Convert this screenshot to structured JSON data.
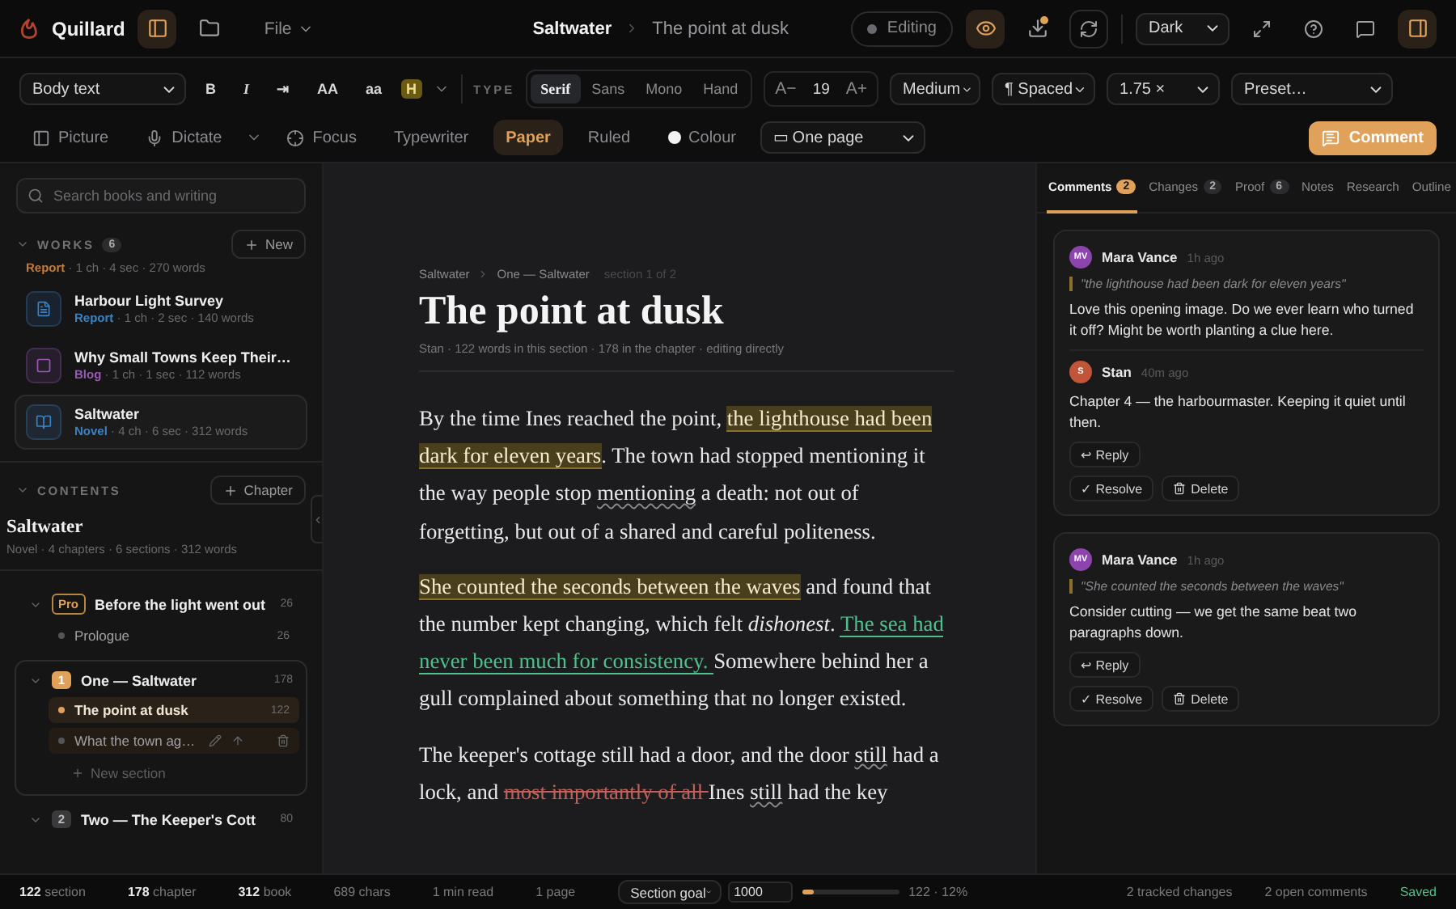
{
  "topbar": {
    "app_name": "Quillard",
    "file_menu": "File",
    "work": "Saltwater",
    "section": "The point at dusk",
    "mode": "Editing",
    "theme": "Dark",
    "left_panel_on": true,
    "preview_on": true,
    "download_badge": true,
    "right_panel_on": true
  },
  "toolbar": {
    "style": "Body text",
    "format": [
      {
        "label": "B",
        "kind": "bold"
      },
      {
        "label": "I",
        "kind": "italic"
      },
      {
        "label": "⇥",
        "kind": "plain"
      },
      {
        "label": "AA",
        "kind": "plain"
      },
      {
        "label": "aa",
        "kind": "plain"
      },
      {
        "label": "H",
        "kind": "highlight"
      }
    ],
    "type_label": "TYPE",
    "fonts": [
      {
        "label": "Serif",
        "selected": true
      },
      {
        "label": "Sans",
        "selected": false
      },
      {
        "label": "Mono",
        "selected": false
      },
      {
        "label": "Hand",
        "selected": false
      }
    ],
    "size_down": "A−",
    "size": "19",
    "size_up": "A+",
    "weight": "Medium",
    "spacing": "¶ Spaced",
    "line_height": "1.75 ×",
    "preset": "Preset…"
  },
  "toolbar2": {
    "items": [
      {
        "label": "Picture",
        "selected": false
      },
      {
        "label": "Dictate",
        "selected": false
      },
      {
        "label": "Focus",
        "selected": false
      },
      {
        "label": "Typewriter",
        "selected": false
      },
      {
        "label": "Paper",
        "selected": true
      },
      {
        "label": "Ruled",
        "selected": false
      },
      {
        "label": "Colour",
        "selected": false
      }
    ],
    "page_mode": "▭ One page",
    "comment_button": "Comment"
  },
  "sidebar": {
    "search": {
      "placeholder": "Search books and writing"
    },
    "works_heading": "WORKS",
    "works_count": "6",
    "new_button": "New",
    "works": [
      {
        "type": "Report",
        "color": "#c47a3a",
        "meta": " · 1 ch · 4 sec · 270 words",
        "selected": false
      },
      {
        "title": "Harbour Light Survey",
        "type": "Report",
        "color": "#3b82c4",
        "meta": " · 1 ch · 2 sec · 140 words",
        "selected": false
      },
      {
        "title": "Why Small Towns Keep Their…",
        "type": "Blog",
        "color": "#9b59b6",
        "meta": " · 1 ch · 1 sec · 112 words",
        "selected": false
      },
      {
        "title": "Saltwater",
        "type": "Novel",
        "color": "#3b82c4",
        "meta": " · 4 ch · 6 sec · 312 words",
        "selected": true
      }
    ],
    "contents_heading": "CONTENTS",
    "chapter_button": "Chapter",
    "book_title": "Saltwater",
    "book_meta": "Novel · 4 chapters · 6 sections · 312 words",
    "chapters": [
      {
        "badge": "Pro",
        "title": "Before the light went out",
        "count": "26",
        "expanded": true,
        "selected": false,
        "sections": [
          {
            "title": "Prologue",
            "count": "26",
            "selected": false
          }
        ]
      },
      {
        "badge": "1",
        "title": "One — Saltwater",
        "count": "178",
        "expanded": true,
        "selected": true,
        "sections": [
          {
            "title": "The point at dusk",
            "count": "122",
            "selected": true
          },
          {
            "title": "What the town ag…",
            "selected": false,
            "hovered": true
          }
        ],
        "new_section": "New section"
      },
      {
        "badge": "2",
        "title": "Two — The Keeper's Cott",
        "count": "80",
        "expanded": true,
        "selected": false
      }
    ]
  },
  "editor": {
    "breadcrumb": [
      "Saltwater",
      "One — Saltwater"
    ],
    "position": "section 1 of 2",
    "title": "The point at dusk",
    "byline": "Stan · 122 words in this section · 178 in the chapter · editing directly",
    "paragraphs": [
      [
        {
          "kind": "plain",
          "text": "By the time Ines reached the point, "
        },
        {
          "kind": "highlight",
          "text": "the lighthouse had been dark for eleven years"
        },
        {
          "kind": "plain",
          "text": ". The town had stopped mentioning it the way people stop "
        },
        {
          "kind": "spell",
          "text": "mentioning"
        },
        {
          "kind": "plain",
          "text": " a death: not out of forgetting, but out of a shared and careful politeness."
        }
      ],
      [
        {
          "kind": "highlight",
          "text": "She counted the seconds between the waves"
        },
        {
          "kind": "plain",
          "text": " and found that the number kept changing, which felt "
        },
        {
          "kind": "italic",
          "text": "dishonest"
        },
        {
          "kind": "plain",
          "text": ". "
        },
        {
          "kind": "insert",
          "text": "The sea had never been much for consistency. "
        },
        {
          "kind": "plain",
          "text": "Somewhere behind her a gull complained about something that no longer existed."
        }
      ],
      [
        {
          "kind": "plain",
          "text": "The keeper's cottage still had a door, and the door "
        },
        {
          "kind": "spell",
          "text": "still"
        },
        {
          "kind": "plain",
          "text": " had a lock, and "
        },
        {
          "kind": "delete",
          "text": "most importantly of all "
        },
        {
          "kind": "plain",
          "text": "Ines "
        },
        {
          "kind": "spell",
          "text": "still"
        },
        {
          "kind": "plain",
          "text": " had the key"
        }
      ]
    ]
  },
  "panel": {
    "tabs": [
      {
        "label": "Comments",
        "count": "2",
        "selected": true
      },
      {
        "label": "Changes",
        "count": "2",
        "selected": false
      },
      {
        "label": "Proof",
        "count": "6",
        "selected": false
      },
      {
        "label": "Notes",
        "selected": false
      },
      {
        "label": "Research",
        "selected": false
      },
      {
        "label": "Outline",
        "selected": false
      }
    ],
    "threads": [
      {
        "initials": "MV",
        "color": "#8e44ad",
        "author": "Mara Vance",
        "time": "1h ago",
        "quote": "\"the lighthouse had been dark for eleven years\"",
        "body": "Love this opening image. Do we ever learn who turned it off? Might be worth planting a clue here.",
        "replies": [
          {
            "initials": "S",
            "color": "#c0553a",
            "author": "Stan",
            "time": "40m ago",
            "body": "Chapter 4 — the harbourmaster. Keeping it quiet until then."
          }
        ],
        "reply": "↩ Reply",
        "resolve": "✓ Resolve",
        "delete": "Delete"
      },
      {
        "initials": "MV",
        "color": "#8e44ad",
        "author": "Mara Vance",
        "time": "1h ago",
        "quote": "\"She counted the seconds between the waves\"",
        "body": "Consider cutting — we get the same beat two paragraphs down.",
        "reply": "↩ Reply",
        "resolve": "✓ Resolve",
        "delete": "Delete"
      }
    ]
  },
  "status_bar": {
    "counts": [
      {
        "value": "122",
        "label": "section"
      },
      {
        "value": "178",
        "label": "chapter"
      },
      {
        "value": "312",
        "label": "book"
      }
    ],
    "stats": [
      "689 chars",
      "1 min read",
      "1 page"
    ],
    "goal_select": "Section goal",
    "goal_value": "1000",
    "goal": {
      "level": 0.12,
      "reading": "122 · 12%"
    },
    "changes": "2 tracked changes",
    "comments": "2 open comments",
    "saved": "Saved"
  }
}
